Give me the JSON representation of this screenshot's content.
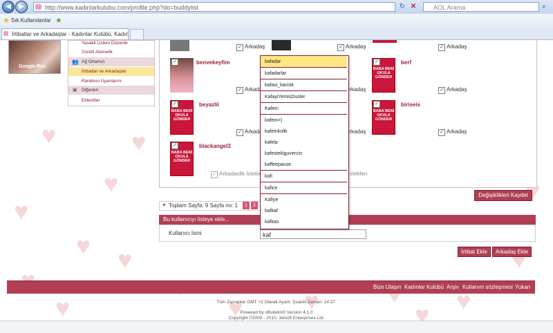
{
  "browser": {
    "url": "http://www.kadinlarkulubu.com/profile.php?do=buddylist",
    "search_placeholder": "AOL Arama",
    "favorites_label": "Sık Kullanılanlar",
    "tab_title": "İrtibatlar ve Arkadaşlar - Kadınlar Kulübü, Kadın, ..."
  },
  "sidebar": {
    "avatar_caption": "Google Res",
    "items": [
      {
        "label": "Yasakli Listeni Düzenle"
      },
      {
        "label": "Ücretli Abonelik"
      },
      {
        "label": "Ağ Ortamın"
      },
      {
        "label": "İrtibatlar ve Arkadaşlar"
      },
      {
        "label": "Randevu Uyarılarını"
      },
      {
        "label": "Diğerleri"
      },
      {
        "label": "Eklentiler"
      }
    ]
  },
  "friend_label": "Arkadaş",
  "friend_request_label": "Arkadaslik Istekle",
  "friend_request_tail": "stekleri",
  "thumb_text": "BABA BENİ OKULA GÖNDER",
  "friends": [
    {
      "name": "benvekeyfim"
    },
    {
      "name": "berf"
    },
    {
      "name": "beyazlii"
    },
    {
      "name": "biriseis"
    },
    {
      "name": "blackangel3"
    }
  ],
  "save_button": "Değişiklikleri Kaydet",
  "pager": {
    "label": "Toplam Sayfa: 9 Sayfa no: 1",
    "pages": [
      "1",
      "2"
    ]
  },
  "add_user": {
    "header": "Bu kullanıcıyı listeye ekle...",
    "field_label": "Kullanıcı İsmi",
    "field_value": "kaf"
  },
  "buttons": {
    "contact": "İrtibat Ekle",
    "friend": "Arkadaş Ekle"
  },
  "autocomplete": [
    "kafadar",
    "kafadarlar",
    "kafasi_karisik",
    "KafayiYemisDusler",
    "Kafein",
    "kafein=)",
    "kafeinkolik",
    "kafela",
    "kafesteki̇guvercin",
    "kaffeepause",
    "kafi",
    "kafice",
    "Kafiye",
    "kafkaf",
    "kafkas"
  ],
  "footer": {
    "links": [
      "Bize Ulaşın",
      "Kadınlar Kulübü",
      "Arşiv",
      "Kullanım sözleşmesi",
      "Yukarı"
    ],
    "timezone": "Tüm Zamanlar GMT +2 Olarak Ayarlı. Şuanki Zaman: 14:37.",
    "powered": "Powered by vBulletin® Version 4.1.0",
    "copyright": "Copyright ©2000 - 2010, Jelsoft Enterprises Ltd."
  }
}
